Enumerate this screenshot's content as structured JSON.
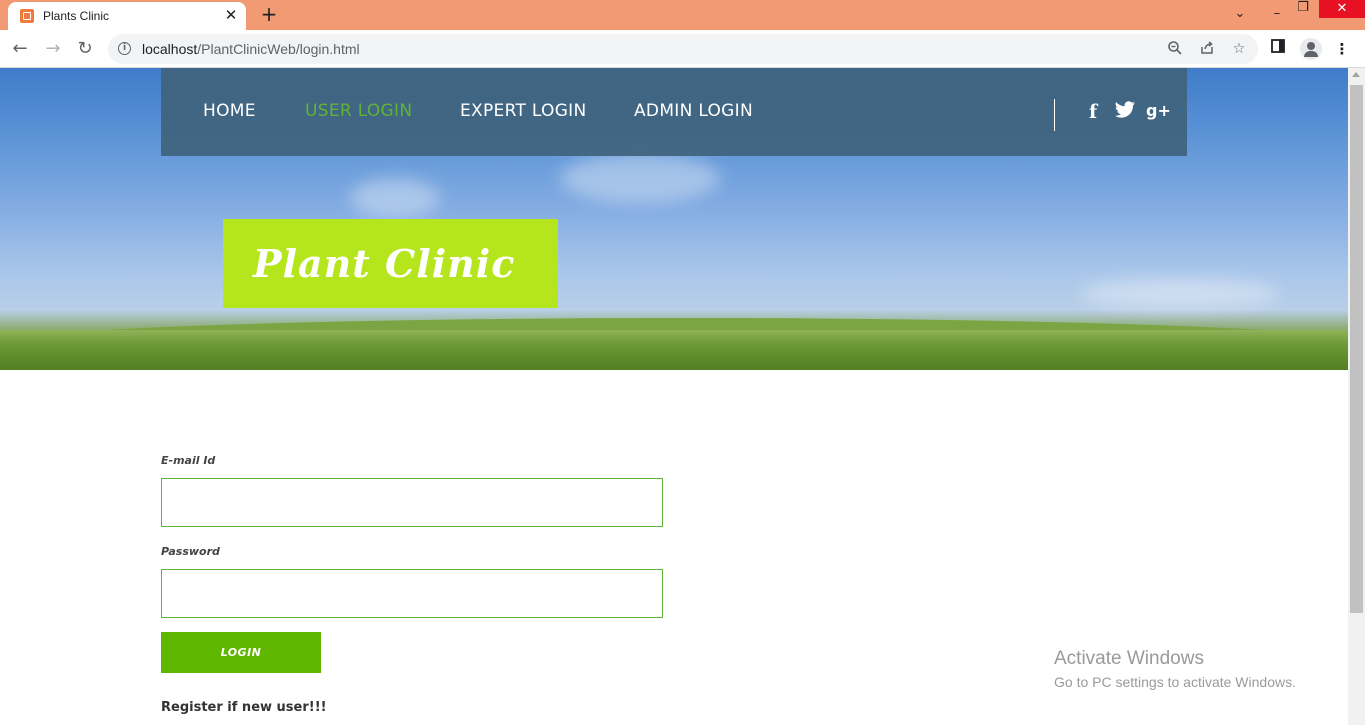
{
  "browser": {
    "tab_title": "Plants Clinic",
    "tab_close": "✕",
    "new_tab": "+",
    "url_host": "localhost",
    "url_path": "/PlantClinicWeb/login.html",
    "window_controls": {
      "dropdown": "⌄",
      "minimize": "–",
      "restore": "❐",
      "close": "✕"
    }
  },
  "site": {
    "nav": {
      "items": [
        {
          "label": "HOME",
          "active": false
        },
        {
          "label": "USER LOGIN",
          "active": true
        },
        {
          "label": "EXPERT LOGIN",
          "active": false
        },
        {
          "label": "ADMIN LOGIN",
          "active": false
        }
      ],
      "social": {
        "facebook": "f",
        "twitter": "🐦",
        "googleplus": "g+"
      }
    },
    "logo_text": "Plant Clinic",
    "form": {
      "email_label": "E-mail Id",
      "email_value": "",
      "password_label": "Password",
      "password_value": "",
      "login_button": "LOGIN",
      "register_text": "Register if new user!!!"
    }
  },
  "watermark": {
    "title": "Activate Windows",
    "subtitle": "Go to PC settings to activate Windows."
  },
  "colors": {
    "accent_green": "#5fb336",
    "logo_green": "#b5e61d",
    "nav_bg": "#3f637d",
    "tab_bar": "#f29a73"
  }
}
